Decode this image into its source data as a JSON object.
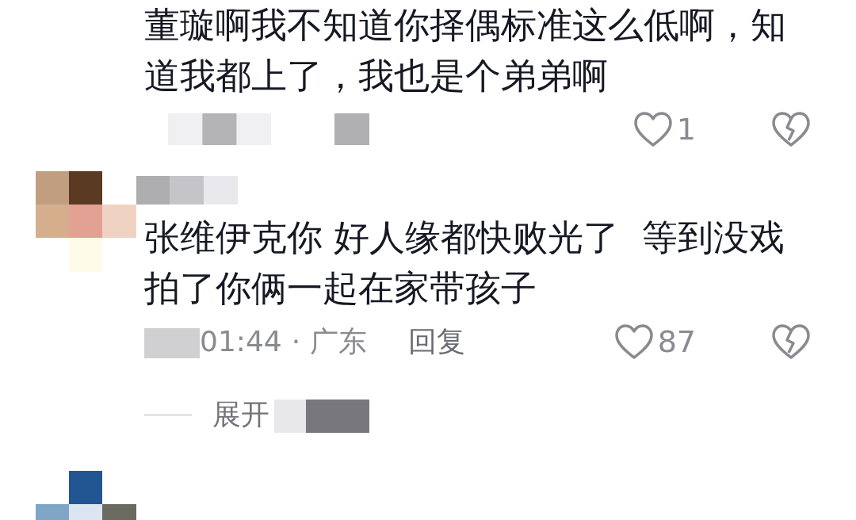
{
  "comments": [
    {
      "kind": "partial",
      "text": "董璇啊我不知道你择偶标准这么低啊，知道我都上了，我也是个弟弟啊",
      "meta_pixelated": true,
      "likes": "1",
      "liked": false,
      "disliked": false
    },
    {
      "kind": "full",
      "avatar_pixelated": true,
      "username_pixelated": true,
      "text": "张维伊克你 好人缘都快败光了  等到没戏拍了你俩一起在家带孩子",
      "time": "01:44",
      "time_pixelated": true,
      "separator": "·",
      "location": "广东",
      "reply": "回复",
      "likes": "87",
      "liked": false,
      "disliked": false,
      "expand": "展开",
      "expand_pixelated": true
    },
    {
      "kind": "avatar_only",
      "avatar_pixelated": true
    }
  ]
}
